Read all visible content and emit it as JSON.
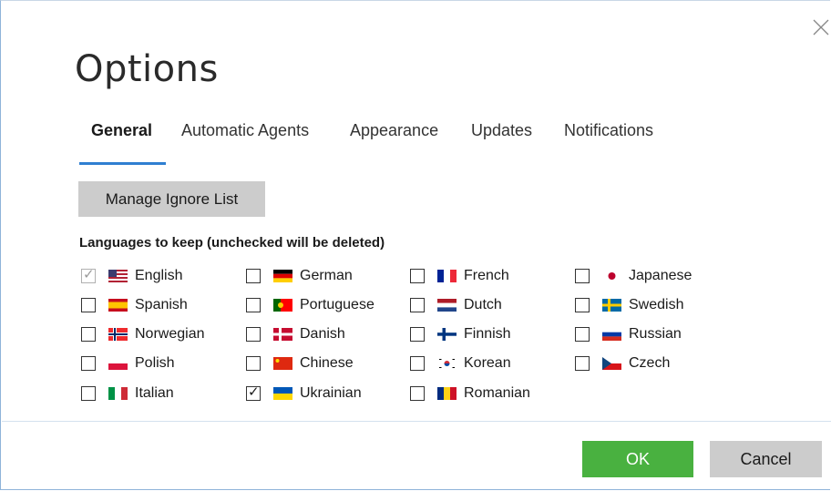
{
  "dialog": {
    "title": "Options",
    "close_icon": "close-icon"
  },
  "tabs": [
    {
      "label": "General",
      "active": true
    },
    {
      "label": "Automatic Agents",
      "active": false
    },
    {
      "label": "Appearance",
      "active": false
    },
    {
      "label": "Updates",
      "active": false
    },
    {
      "label": "Notifications",
      "active": false
    }
  ],
  "general": {
    "manage_ignore_list_label": "Manage Ignore List",
    "languages_heading": "Languages to keep (unchecked will be deleted)",
    "languages": [
      {
        "label": "English",
        "checked": true,
        "disabled": true,
        "flag": "us-flag-icon"
      },
      {
        "label": "Spanish",
        "checked": false,
        "disabled": false,
        "flag": "es-flag-icon"
      },
      {
        "label": "Norwegian",
        "checked": false,
        "disabled": false,
        "flag": "no-flag-icon"
      },
      {
        "label": "Polish",
        "checked": false,
        "disabled": false,
        "flag": "pl-flag-icon"
      },
      {
        "label": "Italian",
        "checked": false,
        "disabled": false,
        "flag": "it-flag-icon"
      },
      {
        "label": "German",
        "checked": false,
        "disabled": false,
        "flag": "de-flag-icon"
      },
      {
        "label": "Portuguese",
        "checked": false,
        "disabled": false,
        "flag": "pt-flag-icon"
      },
      {
        "label": "Danish",
        "checked": false,
        "disabled": false,
        "flag": "dk-flag-icon"
      },
      {
        "label": "Chinese",
        "checked": false,
        "disabled": false,
        "flag": "cn-flag-icon"
      },
      {
        "label": "Ukrainian",
        "checked": true,
        "disabled": false,
        "flag": "ua-flag-icon"
      },
      {
        "label": "French",
        "checked": false,
        "disabled": false,
        "flag": "fr-flag-icon"
      },
      {
        "label": "Dutch",
        "checked": false,
        "disabled": false,
        "flag": "nl-flag-icon"
      },
      {
        "label": "Finnish",
        "checked": false,
        "disabled": false,
        "flag": "fi-flag-icon"
      },
      {
        "label": "Korean",
        "checked": false,
        "disabled": false,
        "flag": "kr-flag-icon"
      },
      {
        "label": "Romanian",
        "checked": false,
        "disabled": false,
        "flag": "ro-flag-icon"
      },
      {
        "label": "Japanese",
        "checked": false,
        "disabled": false,
        "flag": "jp-flag-icon"
      },
      {
        "label": "Swedish",
        "checked": false,
        "disabled": false,
        "flag": "se-flag-icon"
      },
      {
        "label": "Russian",
        "checked": false,
        "disabled": false,
        "flag": "ru-flag-icon"
      },
      {
        "label": "Czech",
        "checked": false,
        "disabled": false,
        "flag": "cz-flag-icon"
      }
    ]
  },
  "footer": {
    "ok_label": "OK",
    "cancel_label": "Cancel"
  },
  "colors": {
    "accent": "#2f7fd1",
    "ok_button": "#49b140",
    "secondary_button": "#cccccc"
  }
}
